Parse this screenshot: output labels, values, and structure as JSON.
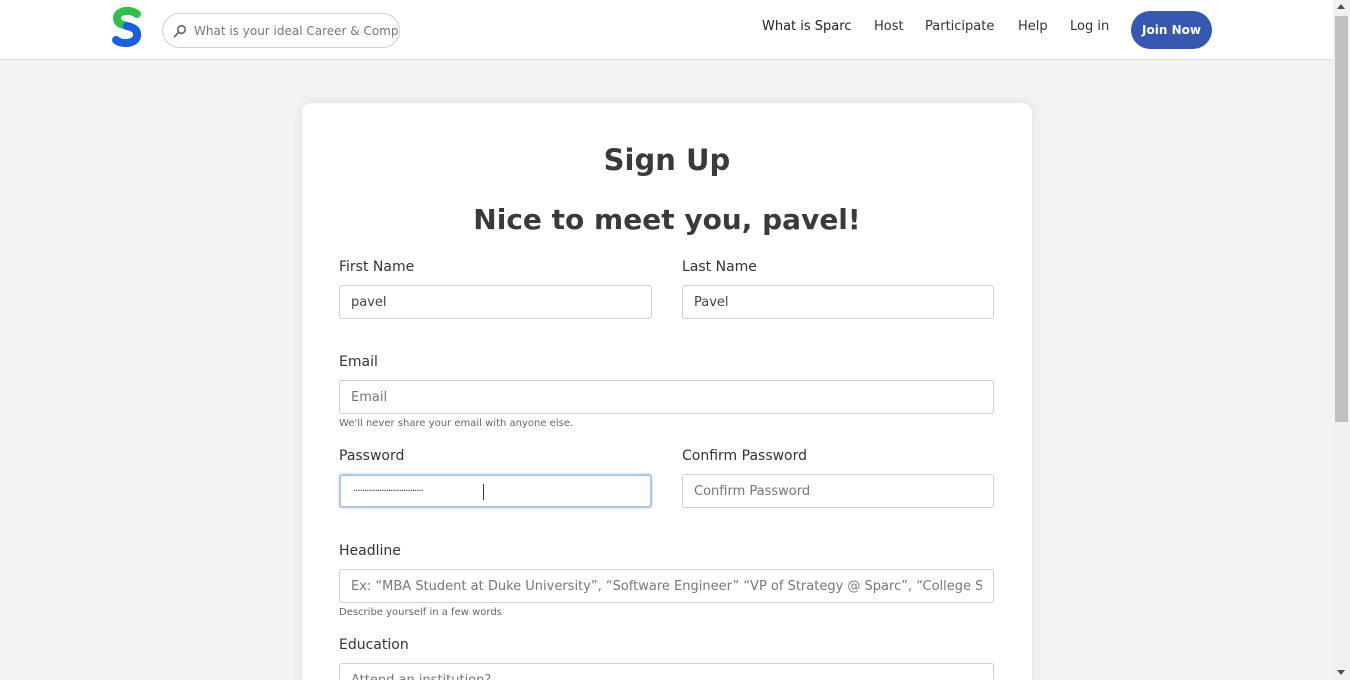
{
  "search": {
    "placeholder": "What is your ideal Career & Company?"
  },
  "nav": {
    "what_is": "What is Sparc",
    "host": "Host",
    "participate": "Participate",
    "help": "Help",
    "login": "Log in",
    "join": "Join Now"
  },
  "form": {
    "title": "Sign Up",
    "greeting": "Nice to meet you, pavel!",
    "first_name": {
      "label": "First Name",
      "value": "pavel"
    },
    "last_name": {
      "label": "Last Name",
      "value": "Pavel"
    },
    "email": {
      "label": "Email",
      "placeholder": "Email",
      "help": "We'll never share your email with anyone else."
    },
    "password": {
      "label": "Password",
      "masked": "································"
    },
    "confirm_password": {
      "label": "Confirm Password",
      "placeholder": "Confirm Password"
    },
    "headline": {
      "label": "Headline",
      "placeholder": "Ex: “MBA Student at Duke University”, “Software Engineer” “VP of Strategy @ Sparc”, “College Student”",
      "help": "Describe yourself in a few words"
    },
    "education": {
      "label": "Education",
      "placeholder": "Attend an institution?"
    }
  },
  "colors": {
    "brand_blue": "#3557b0",
    "logo_green": "#2ec04a",
    "logo_blue": "#1a5fe0"
  }
}
